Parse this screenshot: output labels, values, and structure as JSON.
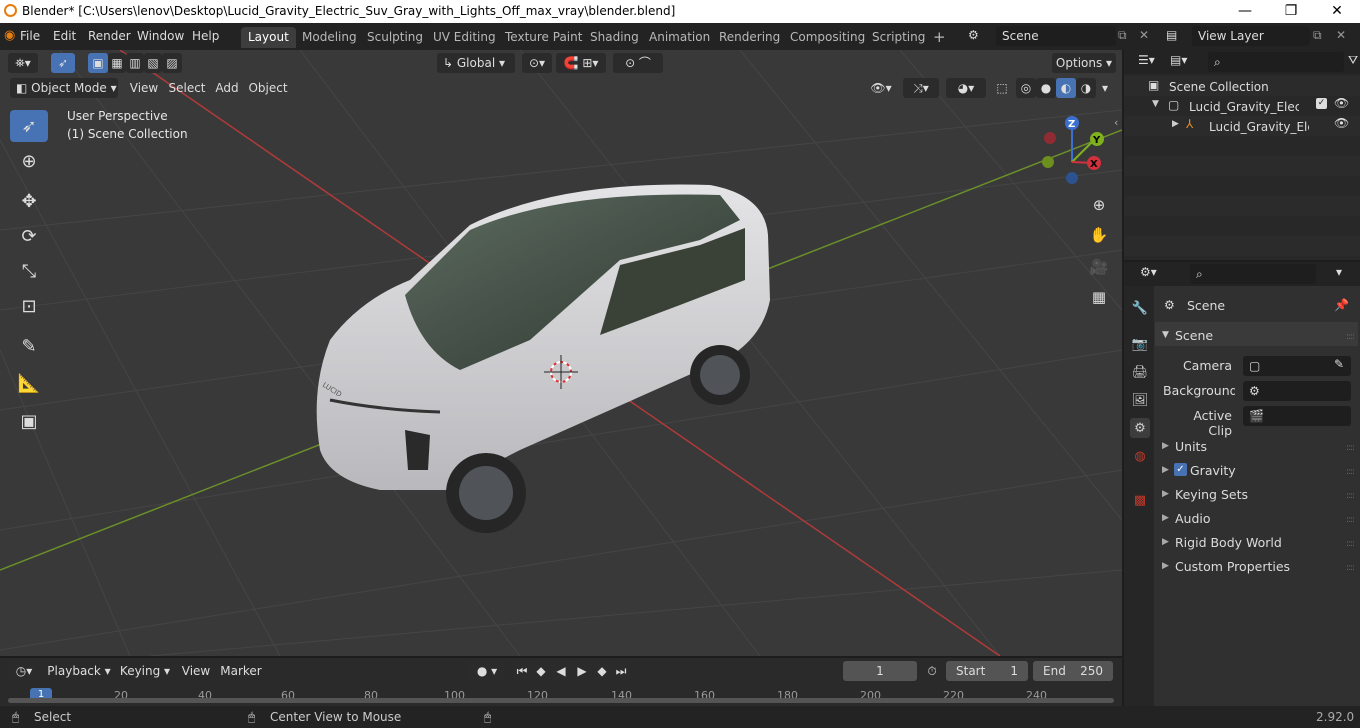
{
  "window": {
    "title": "Blender* [C:\\Users\\lenov\\Desktop\\Lucid_Gravity_Electric_Suv_Gray_with_Lights_Off_max_vray\\blender.blend]",
    "minimize": "—",
    "maximize": "❐",
    "close": "✕"
  },
  "menu": [
    "File",
    "Edit",
    "Render",
    "Window",
    "Help"
  ],
  "workspaces": [
    "Layout",
    "Modeling",
    "Sculpting",
    "UV Editing",
    "Texture Paint",
    "Shading",
    "Animation",
    "Rendering",
    "Compositing",
    "Scripting"
  ],
  "active_workspace": "Layout",
  "scene_field": "Scene",
  "view_layer_field": "View Layer",
  "viewport": {
    "mode": "Object Mode",
    "menus": [
      "View",
      "Select",
      "Add",
      "Object"
    ],
    "transform_orientation": "Global",
    "options_label": "Options",
    "overlay_text_1": "User Perspective",
    "overlay_text_2": "(1) Scene Collection",
    "gizmo": {
      "z": "Z",
      "y": "Y",
      "x": "X"
    },
    "car_brand": "LUCID"
  },
  "outliner": {
    "root": "Scene Collection",
    "collection": "Lucid_Gravity_Electric_S",
    "object": "Lucid_Gravity_Electr"
  },
  "properties": {
    "context": "Scene",
    "panel": "Scene",
    "camera_label": "Camera",
    "background_label": "Background ...",
    "active_clip_label": "Active Clip",
    "sections": [
      "Units",
      "Gravity",
      "Keying Sets",
      "Audio",
      "Rigid Body World",
      "Custom Properties"
    ],
    "gravity_checked": true
  },
  "timeline": {
    "menus": [
      "Playback",
      "Keying",
      "View",
      "Marker"
    ],
    "current_frame": "1",
    "start_label": "Start",
    "start_value": "1",
    "end_label": "End",
    "end_value": "250",
    "ticks": [
      "1",
      "20",
      "40",
      "60",
      "80",
      "100",
      "120",
      "140",
      "160",
      "180",
      "200",
      "220",
      "240"
    ]
  },
  "statusbar": {
    "select": "Select",
    "center_view": "Center View to Mouse",
    "version": "2.92.0"
  },
  "colors": {
    "accent": "#4772b3",
    "grid_x": "#b03a3a",
    "grid_y": "#6a8f2a",
    "viewport_bg": "#393939"
  }
}
